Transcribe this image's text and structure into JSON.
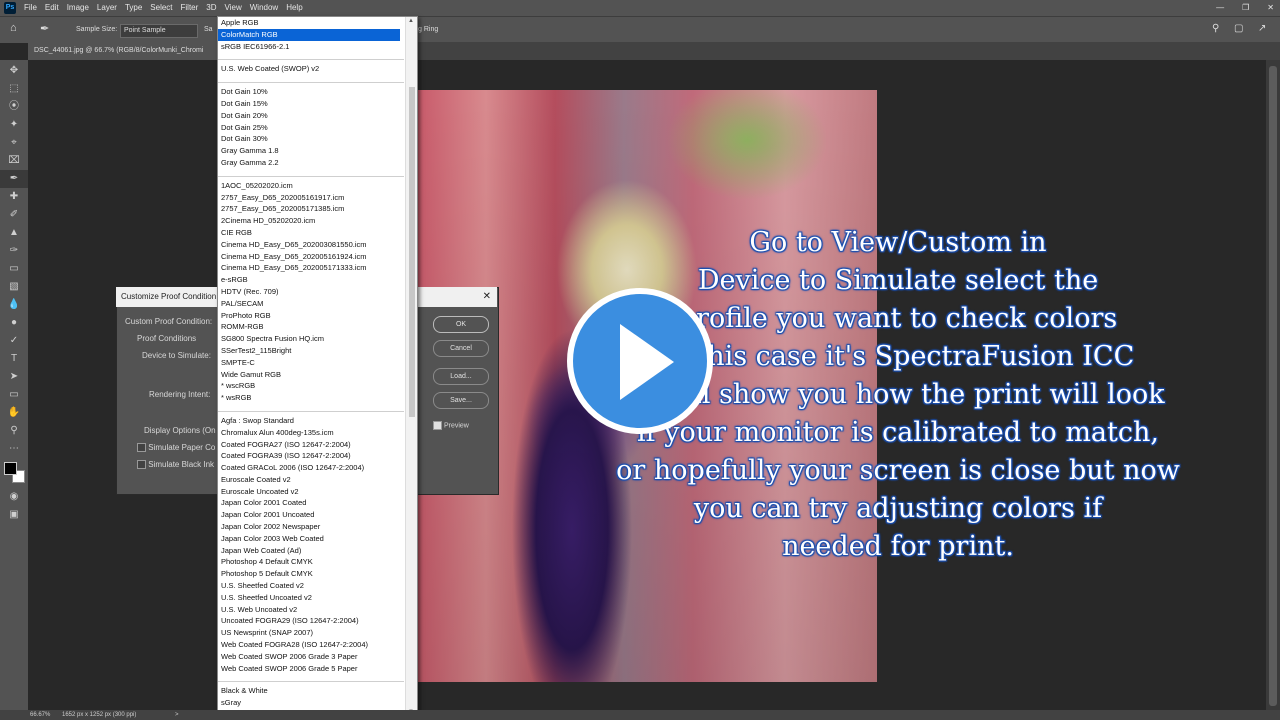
{
  "menubar": {
    "app_icon": "Ps",
    "items": [
      "File",
      "Edit",
      "Image",
      "Layer",
      "Type",
      "Select",
      "Filter",
      "3D",
      "View",
      "Window",
      "Help"
    ],
    "window_controls": [
      "minimize-icon",
      "restore-icon",
      "close-icon"
    ]
  },
  "options_bar": {
    "sample_size_label": "Sample Size:",
    "sample_size_value": "Point Sample",
    "sample_label": "Sa",
    "sample_ring": "g Ring"
  },
  "document": {
    "tab_title": "DSC_44061.jpg @ 66.7% (RGB/8/ColorMunki_Chromi"
  },
  "status": {
    "zoom": "66.67%",
    "doc_info": "1652 px x 1252 px (300 ppi)",
    "arrow": ">"
  },
  "dialog": {
    "title": "Customize Proof Condition",
    "custom_label": "Custom Proof Condition:",
    "proof_conditions": "Proof Conditions",
    "device_label": "Device to Simulate:",
    "rendering_label": "Rendering Intent:",
    "display_options": "Display Options (On",
    "simulate_paper": "Simulate Paper Co",
    "simulate_black": "Simulate Black Ink",
    "ok": "OK",
    "cancel": "Cancel",
    "load": "Load...",
    "save": "Save...",
    "preview": "Preview",
    "close": "✕"
  },
  "dropdown": {
    "group1": [
      "Apple RGB",
      "ColorMatch RGB",
      "sRGB IEC61966-2.1"
    ],
    "selected_index": 1,
    "group2": [
      "U.S. Web Coated (SWOP) v2"
    ],
    "group3": [
      "Dot Gain 10%",
      "Dot Gain 15%",
      "Dot Gain 20%",
      "Dot Gain 25%",
      "Dot Gain 30%",
      "Gray Gamma 1.8",
      "Gray Gamma 2.2"
    ],
    "group4": [
      "1AOC_05202020.icm",
      "2757_Easy_D65_202005161917.icm",
      "2757_Easy_D65_202005171385.icm",
      "2Cinema HD_05202020.icm",
      "CIE RGB",
      "Cinema HD_Easy_D65_202003081550.icm",
      "Cinema HD_Easy_D65_202005161924.icm",
      "Cinema HD_Easy_D65_202005171333.icm",
      "e-sRGB",
      "HDTV (Rec. 709)",
      "PAL/SECAM",
      "ProPhoto RGB",
      "ROMM-RGB",
      "SG800 Spectra Fusion HQ.icm",
      "SSerTest2_115Bright",
      "SMPTE-C",
      "Wide Gamut RGB",
      "* wscRGB",
      "* wsRGB"
    ],
    "group5": [
      "Agfa : Swop Standard",
      "Chromalux Alun 400deg-135s.icm",
      "Coated FOGRA27 (ISO 12647-2:2004)",
      "Coated FOGRA39 (ISO 12647-2:2004)",
      "Coated GRACoL 2006 (ISO 12647-2:2004)",
      "Euroscale Coated v2",
      "Euroscale Uncoated v2",
      "Japan Color 2001 Coated",
      "Japan Color 2001 Uncoated",
      "Japan Color 2002 Newspaper",
      "Japan Color 2003 Web Coated",
      "Japan Web Coated (Ad)",
      "Photoshop 4 Default CMYK",
      "Photoshop 5 Default CMYK",
      "U.S. Sheetfed Coated v2",
      "U.S. Sheetfed Uncoated v2",
      "U.S. Web Uncoated v2",
      "Uncoated FOGRA29 (ISO 12647-2:2004)",
      "US Newsprint (SNAP 2007)",
      "Web Coated FOGRA28 (ISO 12647-2:2004)",
      "Web Coated SWOP 2006 Grade 3 Paper",
      "Web Coated SWOP 2006 Grade 5 Paper"
    ],
    "group6": [
      "Black & White",
      "sGray"
    ]
  },
  "caption": {
    "lines": [
      "Go to View/Custom in",
      "Device to Simulate select the",
      "profile you want to check colors",
      "in this case it's SpectraFusion ICC",
      "It will show you how the print will look",
      "if your monitor is calibrated to match,",
      "or hopefully your screen is close but now",
      "you can try adjusting colors if",
      "needed for print."
    ]
  },
  "colors": {
    "accent": "#0a64d6",
    "play": "#3b8ee0",
    "caption_outline": "#1a4fb0"
  }
}
